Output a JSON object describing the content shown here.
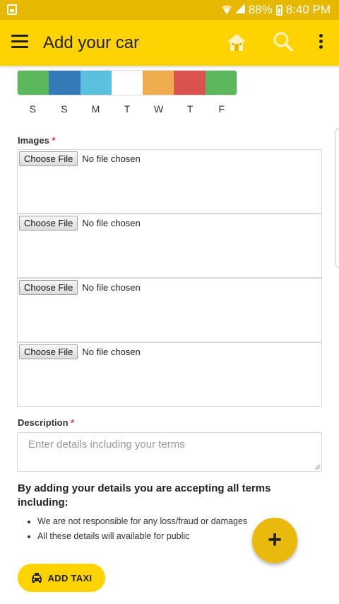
{
  "status_bar": {
    "battery": "88%",
    "time": "8:40 PM"
  },
  "app_bar": {
    "title": "Add your car",
    "icons": [
      "menu-icon",
      "home-icon",
      "search-icon",
      "more-vert-icon"
    ]
  },
  "availability": {
    "days": [
      "S",
      "S",
      "M",
      "T",
      "W",
      "T",
      "F"
    ],
    "colors": [
      "#5cb85c",
      "#337ab7",
      "#5bc0de",
      "#ffffff",
      "#f0ad4e",
      "#d9534f",
      "#5cb85c"
    ]
  },
  "images": {
    "label": "Images",
    "required_mark": "*",
    "inputs": [
      {
        "button": "Choose File",
        "status": "No file chosen"
      },
      {
        "button": "Choose File",
        "status": "No file chosen"
      },
      {
        "button": "Choose File",
        "status": "No file chosen"
      },
      {
        "button": "Choose File",
        "status": "No file chosen"
      }
    ]
  },
  "description": {
    "label": "Description",
    "required_mark": "*",
    "placeholder": "Enter details including your terms",
    "value": ""
  },
  "terms": {
    "heading": "By adding your details you are accepting all terms including:",
    "items": [
      "We are not responsible for any loss/fraud or damages",
      "All these details will available for public"
    ]
  },
  "fab": {
    "label": "+"
  },
  "add_button": {
    "label": "ADD TAXI",
    "icon": "taxi-icon"
  },
  "colors": {
    "status_bar": "#e6b800",
    "app_bar": "#ffd300",
    "fab": "#e9b90c",
    "required": "#d9363e"
  }
}
